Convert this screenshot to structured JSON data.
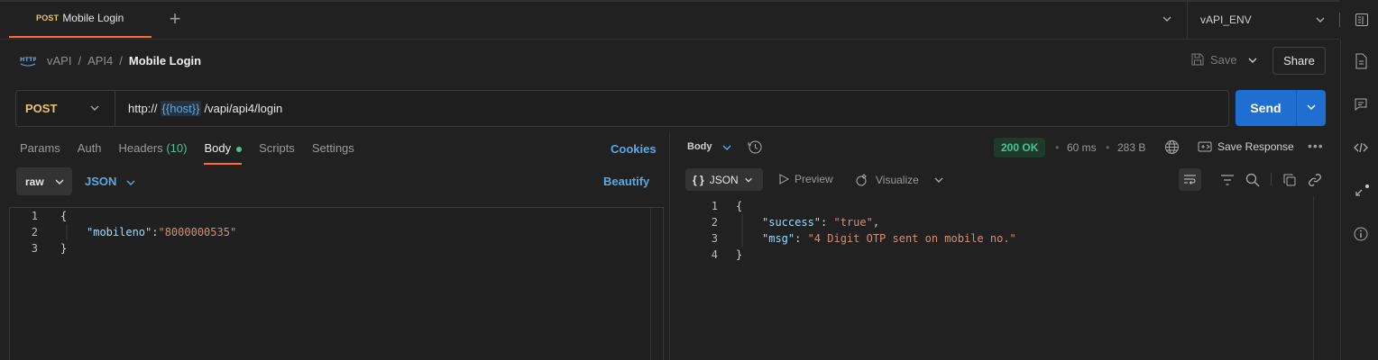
{
  "tabs": [
    {
      "method": "POST",
      "name": "Mobile Login"
    }
  ],
  "environment": {
    "name": "vAPI_ENV"
  },
  "breadcrumb": {
    "items": [
      "vAPI",
      "API4",
      "Mobile Login"
    ],
    "icon": "HTTP"
  },
  "toolbar": {
    "save_label": "Save",
    "share_label": "Share"
  },
  "request": {
    "method": "POST",
    "url_prefix": "http://",
    "url_var": "{{host}}",
    "url_suffix": "/vapi/api4/login",
    "send_label": "Send"
  },
  "request_tabs": {
    "params": "Params",
    "auth": "Auth",
    "headers": "Headers",
    "headers_count": "(10)",
    "body": "Body",
    "scripts": "Scripts",
    "settings": "Settings",
    "cookies": "Cookies"
  },
  "body_options": {
    "mode": "raw",
    "format": "JSON",
    "beautify": "Beautify"
  },
  "request_body": {
    "lines": [
      {
        "n": "1",
        "text": "{"
      },
      {
        "n": "2",
        "key": "\"mobileno\"",
        "colon": ":",
        "value": "\"8000000535\""
      },
      {
        "n": "3",
        "text": "}"
      }
    ]
  },
  "response": {
    "section_label": "Body",
    "status": "200 OK",
    "time": "60 ms",
    "size": "283 B",
    "save_label": "Save Response",
    "view_format": "JSON",
    "preview_label": "Preview",
    "visualize_label": "Visualize",
    "lines": [
      {
        "n": "1",
        "text": "{"
      },
      {
        "n": "2",
        "key": "\"success\"",
        "colon": ": ",
        "value": "\"true\"",
        "trail": ","
      },
      {
        "n": "3",
        "key": "\"msg\"",
        "colon": ": ",
        "value": "\"4 Digit OTP sent on mobile no.\"",
        "trail": ""
      },
      {
        "n": "4",
        "text": "}"
      }
    ]
  },
  "colors": {
    "accent": "#ff6c37",
    "send": "#1f6fd1",
    "method_post": "#e9c46a",
    "status_ok": "#4ec18e",
    "link": "#5aa9e6"
  }
}
